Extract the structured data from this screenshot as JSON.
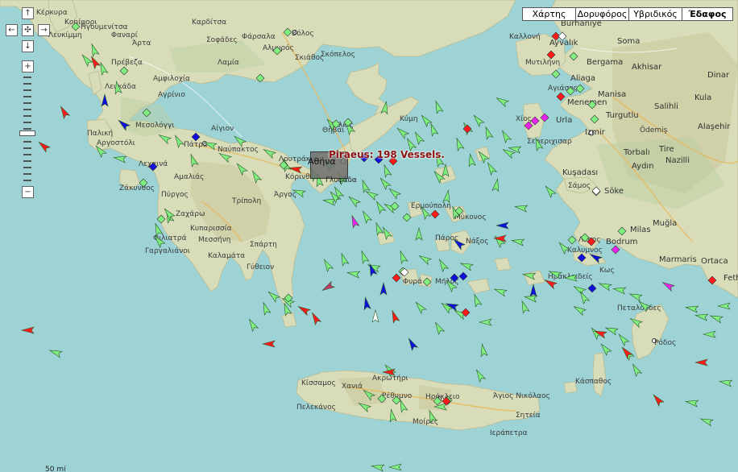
{
  "map_type_buttons": [
    "Χάρτης",
    "Δορυφόρος",
    "Υβριδικός",
    "Έδαφος"
  ],
  "map_type_active": "Έδαφος",
  "nav": {
    "up": "↑",
    "left": "←",
    "center": "✣",
    "right": "→",
    "down": "↓",
    "zoom_in": "+",
    "zoom_out": "−"
  },
  "zoom": {
    "level_fraction": 0.55
  },
  "port_label": "Piraeus: 198 Vessels.",
  "athina_label": "Αθήνα",
  "glyfada_label": "Γλυφάδα",
  "scale_text": "50 mi",
  "colors": {
    "sea": "#9ed3d5",
    "land": "#d9dcb9",
    "cargo": "#7ff07f",
    "tanker": "#ff1a1a",
    "passenger": "#1010dd",
    "special": "#ee22ee",
    "other": "#c23a6a"
  },
  "places": [
    "Κέρκυρα",
    "Κοnίψορι",
    "Ηγουμενίτσα",
    "Λευκίμμη",
    "Φαναρί",
    "Άρτα",
    "Πρέβεζα",
    "Λευκάδα",
    "Αμφιλοχία",
    "Αγρίνιο",
    "Μεσολόγγι",
    "Παλική",
    "Αργοστόλι",
    "Πάτρα",
    "Αίγιον",
    "Ναύπακτος",
    "Ζάκυνθος",
    "Λεχαινά",
    "Αμαλιάς",
    "Πύργος",
    "Ζαχάρω",
    "Τρίπολη",
    "Κυπαρισσία",
    "Φιλιατρά",
    "Γαργαλιάνοι",
    "Μεσσήνη",
    "Καλαμάτα",
    "Σπάρτη",
    "Γύθειον",
    "Άργος",
    "Κόρινθος",
    "Λουτράκιον",
    "Θήβαι",
    "Χαλκίς",
    "Λαμία",
    "Καρδίτσα",
    "Φάρσαλα",
    "Σοφάδες",
    "Βόλος",
    "Σκόπελος",
    "Σκιάθος",
    "Αλμυρός",
    "Κύμη",
    "Ερμούπολη",
    "Μύκονος",
    "Πάρος",
    "Νάξος",
    "Φυρά",
    "Μήλος",
    "Κίσσαμος",
    "Χανιά",
    "Ρέθυμνο",
    "Ηράκλειο",
    "Άγιος Νικόλαος",
    "Σητεία",
    "Ιεράπετρα",
    "Μοίρες",
    "Ακρωτήρι",
    "Πελεκάνος",
    "Κάσπαθος",
    "Ρόδος",
    "Κως",
    "Καλυμνος",
    "Λέρος",
    "Ηρακλειδείς",
    "Πεταλούδες",
    "Χίος",
    "Σάμος",
    "Μυτιλήνη",
    "Καλλονή",
    "Αγιάσος",
    "Σεφεριχισαρ",
    "Ayvalık",
    "Burhaniye",
    "Soma",
    "Bergama",
    "Akhisar",
    "Aliaga",
    "Manisa",
    "Turgutlu",
    "Salihli",
    "Kula",
    "Menemen",
    "Izmir",
    "Urla",
    "Ödemiş",
    "Alaşehir",
    "Torbalı",
    "Tire",
    "Nazilli",
    "Aydın",
    "Kuşadası",
    "Söke",
    "Muğla",
    "Milas",
    "Bodrum",
    "Marmaris",
    "Ortaca",
    "Fethiye",
    "Dinar"
  ],
  "vessel_counts": {
    "cargo": 134,
    "tanker": 36,
    "passenger": 19,
    "special": 6,
    "other": 3
  }
}
